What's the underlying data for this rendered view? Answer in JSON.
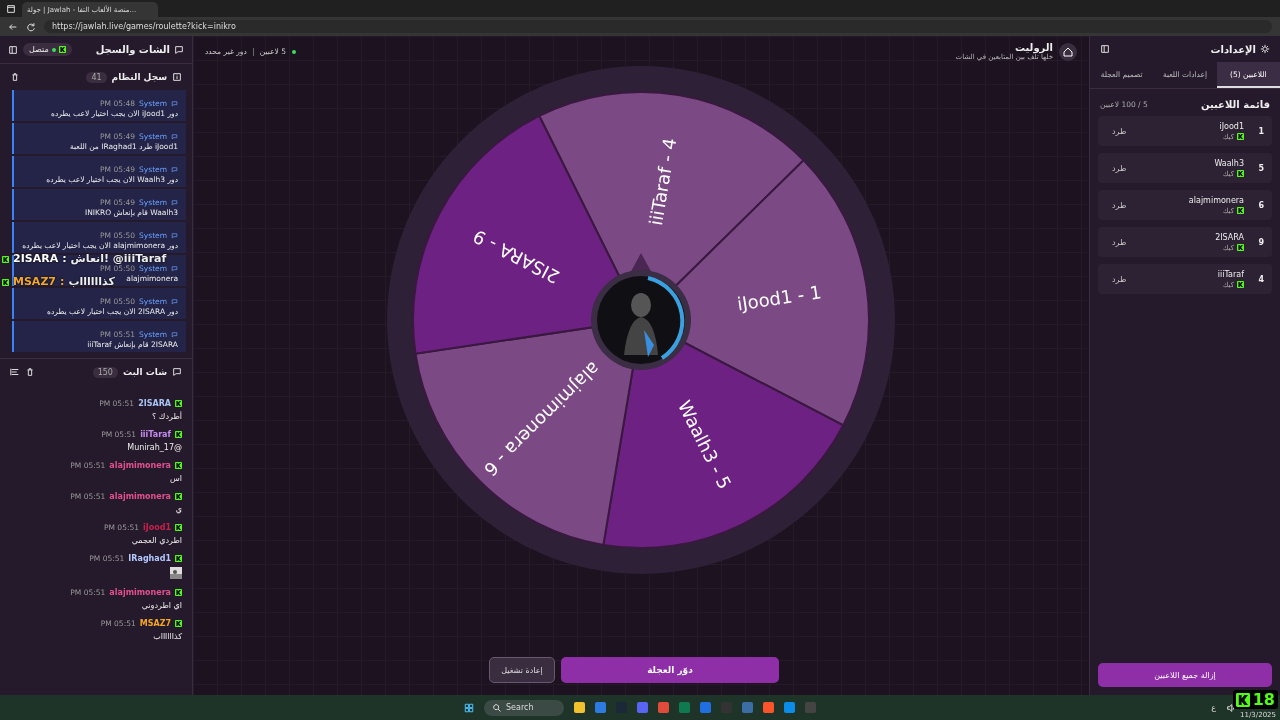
{
  "browser": {
    "tab_title": "جولة | Jawlah - منصة الألعاب التفا...",
    "url": "https://jawlah.live/games/roulette?kick=inikro"
  },
  "left_panel": {
    "title": "الشات والسجل",
    "status": "متصل",
    "system_log": {
      "title": "سجل النظام",
      "count": "41",
      "entries": [
        {
          "sender": "System",
          "time": "PM 05:48",
          "text": "دور iJood1 الان يجب اختيار لاعب يطرده"
        },
        {
          "sender": "System",
          "time": "PM 05:49",
          "text": "iJood1 طرد IRaghad1 من اللعبة"
        },
        {
          "sender": "System",
          "time": "PM 05:49",
          "text": "دور Waalh3 الان يجب اختيار لاعب يطرده"
        },
        {
          "sender": "System",
          "time": "PM 05:49",
          "text": "Waalh3 قام بإنعاش INIKRO"
        },
        {
          "sender": "System",
          "time": "PM 05:50",
          "text": "دور alajmimonera الان يجب اختيار لاعب يطرده"
        },
        {
          "sender": "System",
          "time": "PM 05:50",
          "text": "alajmimonera"
        },
        {
          "sender": "System",
          "time": "PM 05:50",
          "text": "دور 2ISARA الان يجب اختيار لاعب يطرده"
        },
        {
          "sender": "System",
          "time": "PM 05:51",
          "text": "2ISARA قام بإنعاش iiiTaraf"
        }
      ]
    },
    "stream_chat": {
      "title": "شات البث",
      "count": "150",
      "messages": [
        {
          "user": "2ISARA",
          "color": "#a9c4f5",
          "time": "PM 05:51",
          "kind": "text",
          "text": "أطردك ؟"
        },
        {
          "user": "iiiTaraf",
          "color": "#c58cf0",
          "time": "PM 05:51",
          "kind": "text",
          "text": "@Munirah_17"
        },
        {
          "user": "alajmimonera",
          "color": "#e0508f",
          "time": "PM 05:51",
          "kind": "text",
          "text": "اس"
        },
        {
          "user": "alajmimonera",
          "color": "#e0508f",
          "time": "PM 05:51",
          "kind": "text",
          "text": "ي"
        },
        {
          "user": "iJood1",
          "color": "#c8204a",
          "time": "PM 05:51",
          "kind": "text",
          "text": "اطردي العجمي"
        },
        {
          "user": "IRaghad1",
          "color": "#b4c8ff",
          "time": "PM 05:51"
        },
        {
          "user": "alajmimonera",
          "color": "#e0508f",
          "time": "PM 05:51",
          "kind": "text",
          "text": "اي اطردوني"
        },
        {
          "user": "MSAZ7",
          "color": "#f5a623",
          "time": "PM 05:51",
          "kind": "text",
          "text": "كذااااااب"
        }
      ]
    }
  },
  "stream_overlay": [
    {
      "user": "2ISARA",
      "color": "#ffffff",
      "separator": ":",
      "text": "انعاش! @iiiTaraf"
    },
    {
      "user": "MSAZ7",
      "color": "#f5a623",
      "separator": ":",
      "text": "كذااااااب"
    }
  ],
  "header": {
    "title": "الروليت",
    "subtitle": "خلها تلف بين المتابعين في الشات",
    "players": "5 لاعبين",
    "turn": "دور غير محدد"
  },
  "wheel": {
    "segments": [
      {
        "label": "iiiTaraf - 4",
        "color": "#7b4a85"
      },
      {
        "label": "iJood1 - 1",
        "color": "#7b4a85"
      },
      {
        "label": "Waalh3 - 5",
        "color": "#6d2283"
      },
      {
        "label": "alajmimonera - 6",
        "color": "#7b4a85"
      },
      {
        "label": "2ISARA - 9",
        "color": "#6d2283"
      }
    ]
  },
  "actions": {
    "spin": "دوّر العجلة",
    "reset": "إعادة تشغيل"
  },
  "right_panel": {
    "title": "الإعدادات",
    "tabs": [
      {
        "label": "اللاعبين (5)",
        "selected": true
      },
      {
        "label": "إعدادات اللعبة",
        "selected": false
      },
      {
        "label": "تصميم العجلة",
        "selected": false
      }
    ],
    "list_title": "قائمة اللاعبين",
    "capacity": "5 / 100 لاعبين",
    "players": [
      {
        "number": "1",
        "name": "iJood1",
        "platform": "كيك",
        "action": "طرد"
      },
      {
        "number": "5",
        "name": "Waalh3",
        "platform": "كيك",
        "action": "طرد"
      },
      {
        "number": "6",
        "name": "alajmimonera",
        "platform": "كيك",
        "action": "طرد"
      },
      {
        "number": "9",
        "name": "2ISARA",
        "platform": "كيك",
        "action": "طرد"
      },
      {
        "number": "4",
        "name": "iiiTaraf",
        "platform": "كيك",
        "action": "طرد"
      }
    ],
    "clear_button": "إزالة جميع اللاعبين"
  },
  "viewer_count": "18",
  "taskbar": {
    "search": "Search",
    "lang": "ع",
    "date": "11/3/2025"
  }
}
